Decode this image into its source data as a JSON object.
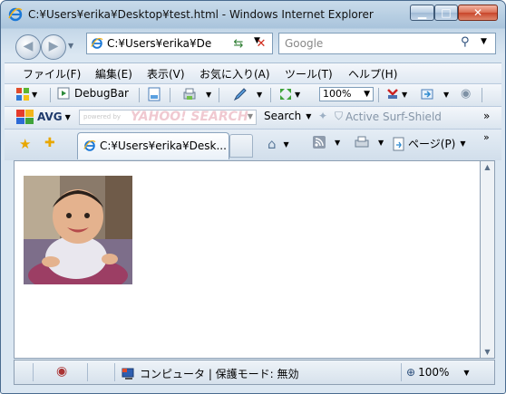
{
  "window": {
    "title": "C:¥Users¥erika¥Desktop¥test.html - Windows Internet Explorer",
    "colors": {
      "frame": "#a9c4dc",
      "close": "#d96d52"
    }
  },
  "navigation": {
    "address": "C:¥Users¥erika¥De",
    "search_placeholder": "Google"
  },
  "menubar": {
    "items": [
      "ファイル(F)",
      "編集(E)",
      "表示(V)",
      "お気に入り(A)",
      "ツール(T)",
      "ヘルプ(H)"
    ]
  },
  "toolbar": {
    "debugbar_label": "DebugBar",
    "zoom_value": "100%"
  },
  "avg_toolbar": {
    "avg_label": "AVG",
    "powered_by": "powered by",
    "yahoo_logo": "YAHOO! SEARCH",
    "search_label": "Search",
    "active_surf_shield": "Active  Surf-Shield"
  },
  "tabs": {
    "active_tab_label": "C:¥Users¥erika¥Desk...",
    "page_menu_label": "ページ(P)"
  },
  "statusbar": {
    "zone_text": "コンピュータ | 保護モード: 無効",
    "zoom": "100%"
  }
}
